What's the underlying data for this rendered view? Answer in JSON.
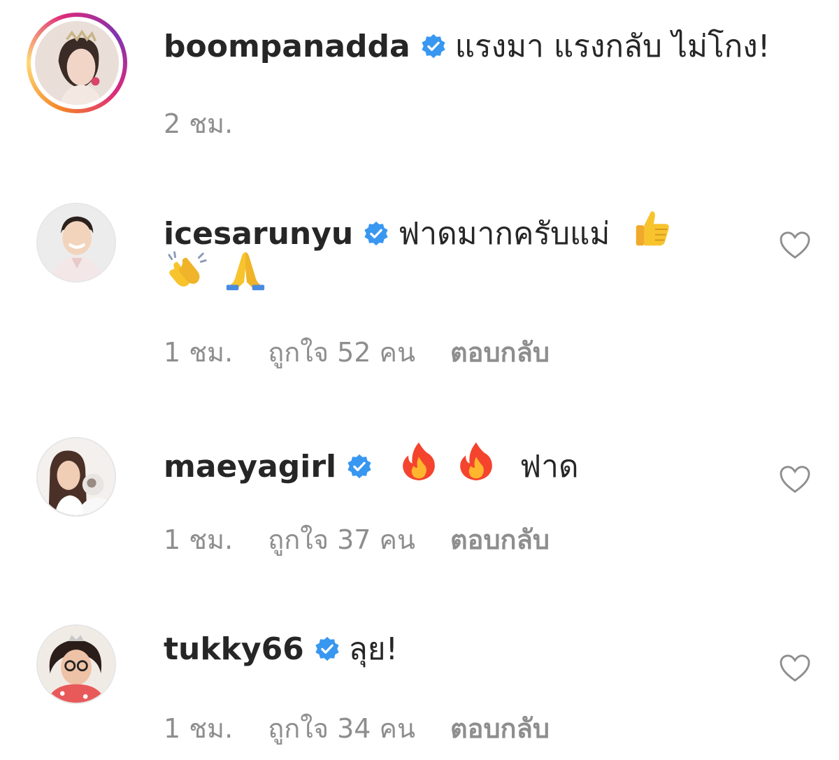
{
  "comments": [
    {
      "username": "boompanadda",
      "text": "แรงมา แรงกลับ ไม่โกง!",
      "emoji": [],
      "time": "2 ชม.",
      "likes": "",
      "reply_label": "",
      "verified": true,
      "has_story_ring": true
    },
    {
      "username": "icesarunyu",
      "text": "ฟาดมากครับแม่",
      "emoji": [
        "thumbs-up",
        "clapping-hands",
        "folded-hands"
      ],
      "time": "1 ชม.",
      "likes": "ถูกใจ 52 คน",
      "reply_label": "ตอบกลับ",
      "verified": true,
      "has_story_ring": false
    },
    {
      "username": "maeyagirl",
      "text": "ฟาด",
      "emoji": [
        "fire",
        "fire"
      ],
      "time": "1 ชม.",
      "likes": "ถูกใจ 37 คน",
      "reply_label": "ตอบกลับ",
      "verified": true,
      "has_story_ring": false
    },
    {
      "username": "tukky66",
      "text": "ลุย!",
      "emoji": [],
      "time": "1 ชม.",
      "likes": "ถูกใจ 34 คน",
      "reply_label": "ตอบกลับ",
      "verified": true,
      "has_story_ring": false
    }
  ],
  "colors": {
    "text": "#262626",
    "meta": "#8e8e8e",
    "verified": "#3897f0",
    "story_ring": [
      "#f58529",
      "#dd2a7b",
      "#8134af"
    ]
  },
  "icons": {
    "verified": "verified-badge-icon",
    "like": "heart-outline-icon"
  }
}
